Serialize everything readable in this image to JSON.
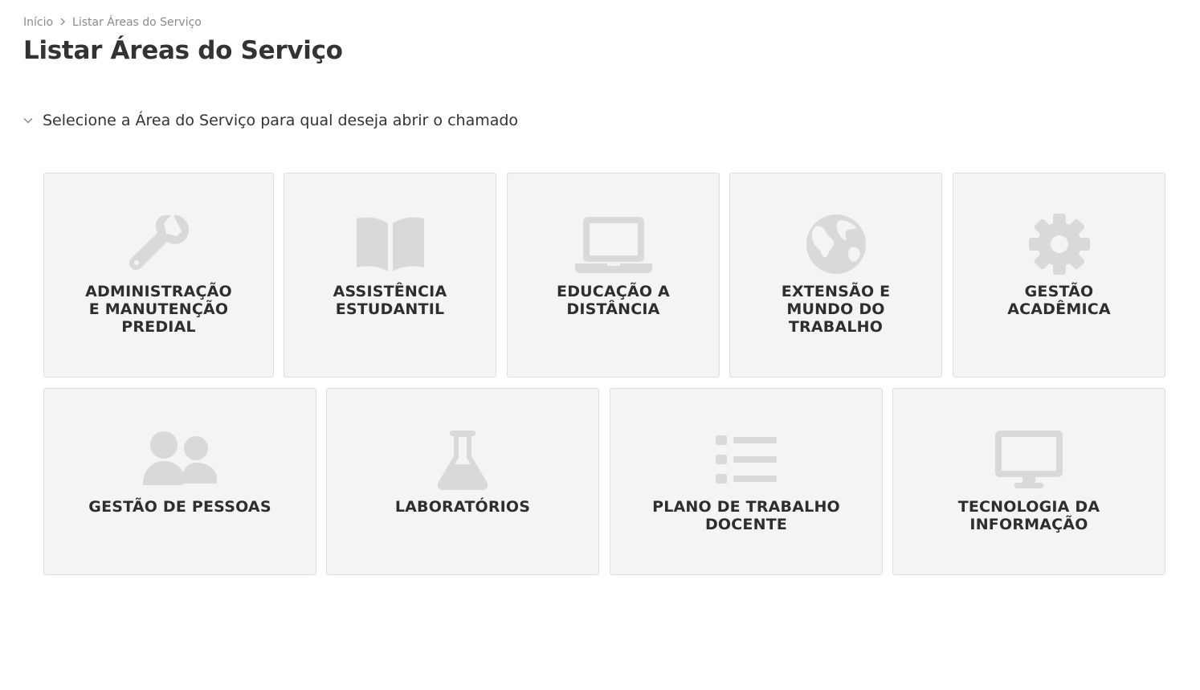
{
  "breadcrumb": {
    "home": "Início",
    "current": "Listar Áreas do Serviço"
  },
  "page_title": "Listar Áreas do Serviço",
  "section": {
    "label": "Selecione a Área do Serviço para qual deseja abrir o chamado",
    "expanded": true
  },
  "colors": {
    "card_bg": "#f4f4f4",
    "card_border": "#dedede",
    "icon": "#d9d9d9",
    "text": "#333333",
    "breadcrumb": "#8a8a8a"
  },
  "areas": [
    {
      "label": "ADMINISTRAÇÃO E MANUTENÇÃO PREDIAL",
      "icon": "wrench-icon"
    },
    {
      "label": "ASSISTÊNCIA ESTUDANTIL",
      "icon": "book-icon"
    },
    {
      "label": "EDUCAÇÃO A DISTÂNCIA",
      "icon": "laptop-icon"
    },
    {
      "label": "EXTENSÃO E MUNDO DO TRABALHO",
      "icon": "globe-icon"
    },
    {
      "label": "GESTÃO ACADÊMICA",
      "icon": "gear-icon"
    },
    {
      "label": "GESTÃO DE PESSOAS",
      "icon": "users-icon"
    },
    {
      "label": "LABORATÓRIOS",
      "icon": "flask-icon"
    },
    {
      "label": "PLANO DE TRABALHO DOCENTE",
      "icon": "list-icon"
    },
    {
      "label": "TECNOLOGIA DA INFORMAÇÃO",
      "icon": "desktop-icon"
    }
  ]
}
